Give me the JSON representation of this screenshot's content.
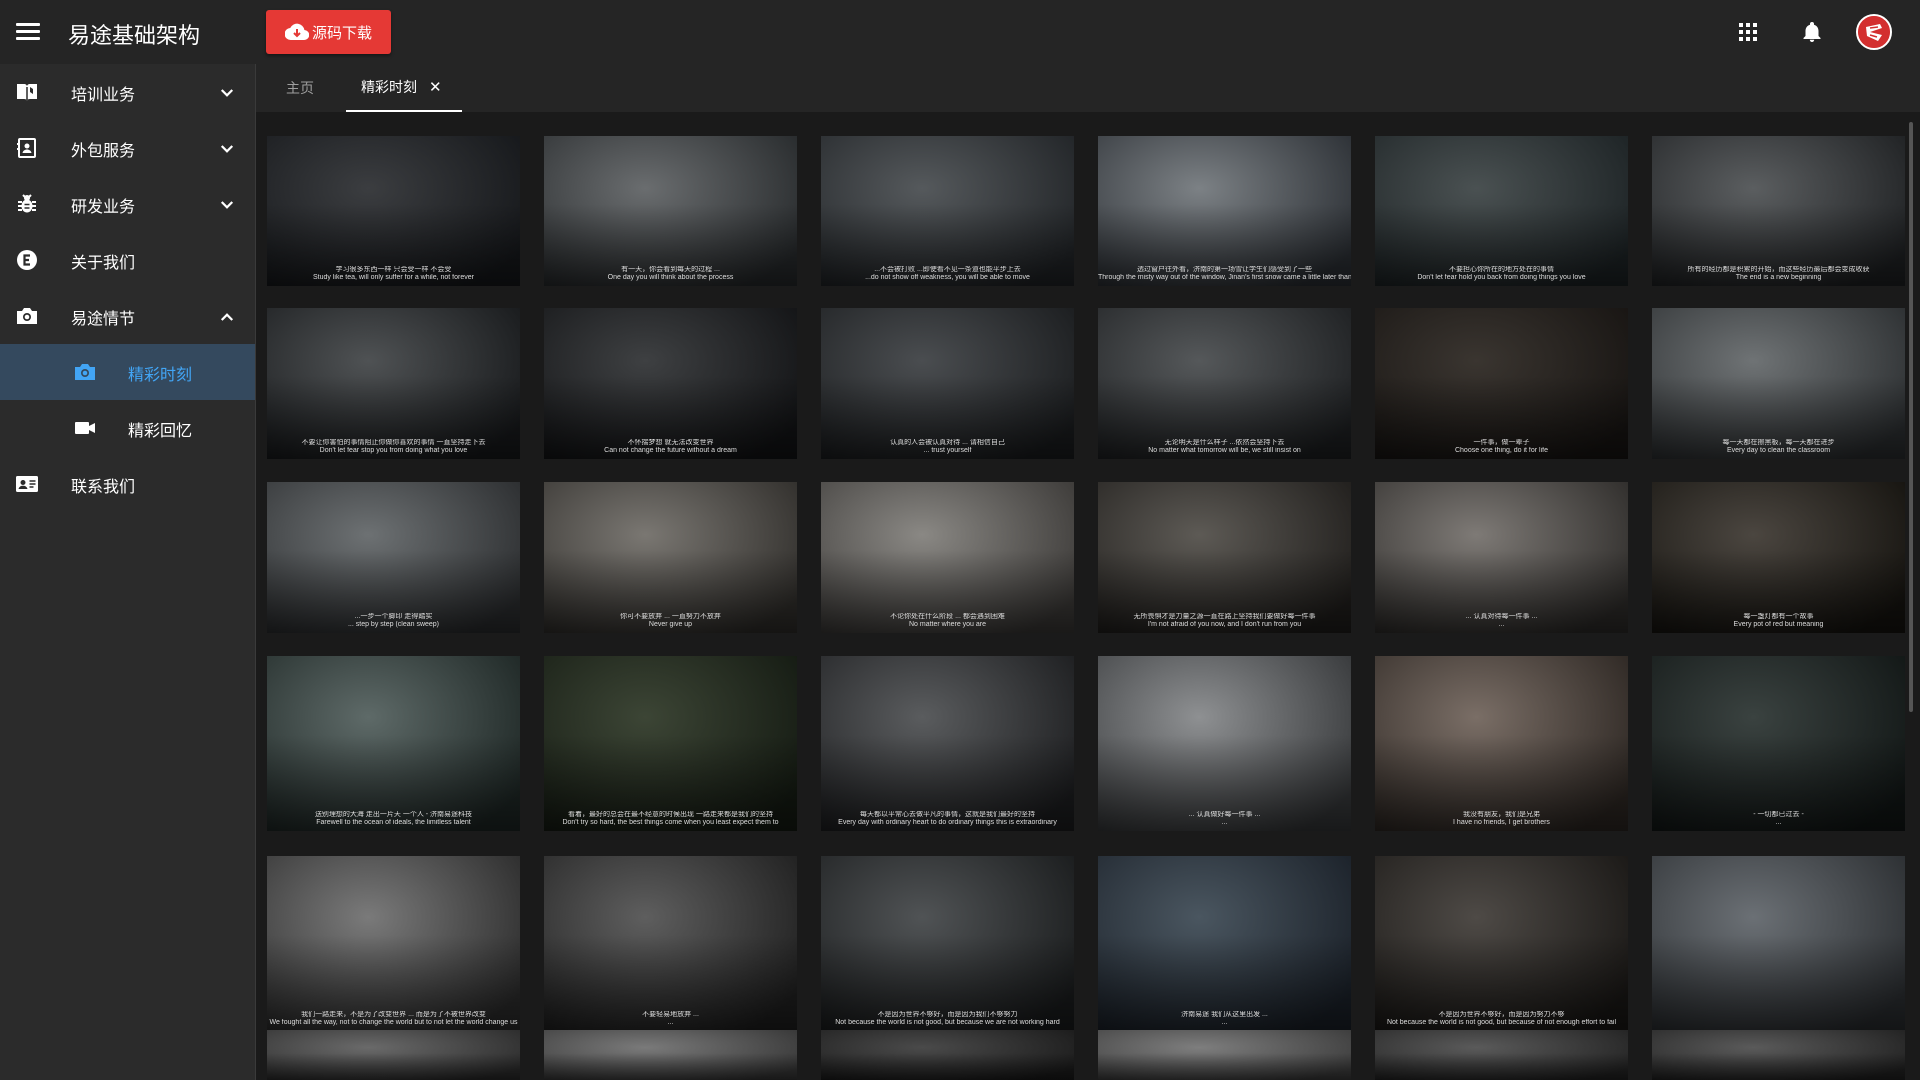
{
  "app": {
    "title": "易途基础架构",
    "download_label": "源码下载",
    "accent_color": "#e53935",
    "active_color": "#42a5f5"
  },
  "header_icons": [
    "apps-grid-icon",
    "bell-icon",
    "avatar-logo"
  ],
  "sidebar": {
    "items": [
      {
        "label": "培训业务",
        "icon": "book-icon",
        "chevron": "down"
      },
      {
        "label": "外包服务",
        "icon": "contact-card-icon",
        "chevron": "down"
      },
      {
        "label": "研发业务",
        "icon": "bug-icon",
        "chevron": "down"
      },
      {
        "label": "关于我们",
        "icon": "e-circle-icon"
      },
      {
        "label": "易途情节",
        "icon": "camera-icon",
        "chevron": "up",
        "expanded": true
      },
      {
        "label": "精彩时刻",
        "icon": "camera-icon",
        "sub": true,
        "active": true
      },
      {
        "label": "精彩回忆",
        "icon": "video-camera-icon",
        "sub": true
      },
      {
        "label": "联系我们",
        "icon": "contact-id-icon"
      }
    ]
  },
  "tabs": {
    "home": "主页",
    "active": "精彩时刻",
    "close_symbol": "✕"
  },
  "gallery": {
    "photos": [
      {
        "cap": [
          "学习很多东西一样 只会受一样 不会受",
          "Study like tea, will only suffer for a while, not forever"
        ],
        "tone": [
          "#3b3d40",
          "#15171a"
        ]
      },
      {
        "cap": [
          "有一天，你会看到每天的过程 ...",
          "One day you will think about the process"
        ],
        "tone": [
          "#6a6d6f",
          "#26292b"
        ]
      },
      {
        "cap": [
          "...不会被打败 ...即使看不见一条道也能平步上去",
          "...do not show off weakness, you will be able to move"
        ],
        "tone": [
          "#55595c",
          "#202326"
        ]
      },
      {
        "cap": [
          "透过窗户往外看，济南的第一场雪让学生们感受到了一些",
          "Through the misty way out of the window, Jinan's first snow came a little later than usual"
        ],
        "tone": [
          "#7c8185",
          "#2a2e33"
        ]
      },
      {
        "cap": [
          "不要担心你所在的地方处在的事情",
          "Don't let fear hold you back from doing things you love"
        ],
        "tone": [
          "#4a5152",
          "#1c2224"
        ]
      },
      {
        "cap": [
          "所有的经历都是积累的开始，而这些经历最后都会变成收获",
          "The end is a new beginning"
        ],
        "tone": [
          "#5b5e60",
          "#1e2022"
        ]
      },
      {
        "cap": [
          "不要让你害怕的事情阻止你做你喜欢的事情 一直坚持走下去",
          "Don't let fear stop you from doing what you love"
        ],
        "tone": [
          "#4f5254",
          "#17191b"
        ]
      },
      {
        "cap": [
          "不怀揣梦想 就无法改变世界",
          "Can not change the future without a dream"
        ],
        "tone": [
          "#3e4042",
          "#121315"
        ]
      },
      {
        "cap": [
          "认真的人会被认真对待 ... 请相信自己",
          "... trust yourself"
        ],
        "tone": [
          "#4a4d50",
          "#1a1c1e"
        ]
      },
      {
        "cap": [
          "无论明天是什么样子 ...依然会坚持下去",
          "No matter what tomorrow will be, we still insist on"
        ],
        "tone": [
          "#55585a",
          "#1d1f21"
        ]
      },
      {
        "cap": [
          "一件事，做一辈子",
          "Choose one thing, do it for life"
        ],
        "tone": [
          "#3a3530",
          "#171412"
        ]
      },
      {
        "cap": [
          "每一天都在擦黑板，每一天都在进步",
          "Every day to clean the classroom"
        ],
        "tone": [
          "#6f7375",
          "#2b2e30"
        ]
      },
      {
        "cap": [
          "...一步一个脚印 走得踏实",
          "... step by step (clean sweep)"
        ],
        "tone": [
          "#6d7173",
          "#2a2c2e"
        ]
      },
      {
        "cap": [
          "你可不要放弃 ... 一直努力不放弃",
          "Never give up"
        ],
        "tone": [
          "#7a7772",
          "#2f2d2a"
        ]
      },
      {
        "cap": [
          "不论你处在什么阶段 ... 都会遇到困难",
          "No matter where you are"
        ],
        "tone": [
          "#8a8884",
          "#3a3836"
        ]
      },
      {
        "cap": [
          "无所畏惧才是力量之源一直在路上坚持我们要做好每一件事",
          "I'm not afraid of you now, and I don't run from you"
        ],
        "tone": [
          "#5d5a55",
          "#1f1d1b"
        ]
      },
      {
        "cap": [
          "... 认真对待每一件事 ...",
          "..."
        ],
        "tone": [
          "#7e7a76",
          "#2d2b29"
        ]
      },
      {
        "cap": [
          "每一盏灯都有一个故事",
          "Every pot of red but meaning"
        ],
        "tone": [
          "#4b4640",
          "#15130f"
        ]
      },
      {
        "cap": [
          "送别理想的大海 走出一片天 一个人 - 济南易途科技",
          "Farewell to the ocean of ideals, the limitless talent"
        ],
        "tone": [
          "#5e6a68",
          "#1d2624"
        ]
      },
      {
        "cap": [
          "看着，最好的总会在最不经意的时候出现 一路走来都是我们的坚持",
          "Don't try so hard, the best things come when you least expect them to"
        ],
        "tone": [
          "#3c4535",
          "#141a12"
        ]
      },
      {
        "cap": [
          "每天都以平常心去做平凡的事情，这就是我们最好的坚持",
          "Every day with ordinary heart to do ordinary things this is extraordinary"
        ],
        "tone": [
          "#5a5c5e",
          "#1c1d1f"
        ]
      },
      {
        "cap": [
          "... 认真做好每一件事 ...",
          "..."
        ],
        "tone": [
          "#8e9092",
          "#353739"
        ]
      },
      {
        "cap": [
          "我没有朋友，我们是兄弟",
          "I have no friends, I get brothers"
        ],
        "tone": [
          "#7a6e66",
          "#2c2622"
        ]
      },
      {
        "cap": [
          "- 一切都已过去 -",
          "..."
        ],
        "tone": [
          "#3a4240",
          "#111615"
        ]
      },
      {
        "cap": [
          "我们一路走来，不是为了改变世界 ... 而是为了不被世界改变",
          "We fought all the way, not to change the world but to not let the world change us"
        ],
        "tone": [
          "#7a7a7a",
          "#2b2b2b"
        ]
      },
      {
        "cap": [
          "不要轻易地放弃 ...",
          "..."
        ],
        "tone": [
          "#5e5e5e",
          "#1f1f1f"
        ]
      },
      {
        "cap": [
          "不是因为世界不够好，而是因为我们不够努力",
          "Not because the world is not good, but because we are not working hard"
        ],
        "tone": [
          "#505355",
          "#191b1c"
        ]
      },
      {
        "cap": [
          "济南易途 我们从这里出发 ...",
          "..."
        ],
        "tone": [
          "#4a5660",
          "#1a2028"
        ]
      },
      {
        "cap": [
          "不是因为世界不够好，而是因为努力不够",
          "Not because the world is not good, but because of not enough effort to fail"
        ],
        "tone": [
          "#4e4a46",
          "#191715"
        ]
      },
      {
        "cap": [
          "",
          ""
        ],
        "tone": [
          "#6b7075",
          "#2a2d30"
        ]
      },
      {
        "cap": [
          "",
          ""
        ],
        "tone": [
          "#6a6a6a",
          "#2a2a2a"
        ]
      },
      {
        "cap": [
          "",
          ""
        ],
        "tone": [
          "#7a7a7a",
          "#353535"
        ]
      },
      {
        "cap": [
          "",
          ""
        ],
        "tone": [
          "#4a4a4a",
          "#1a1a1a"
        ]
      },
      {
        "cap": [
          "",
          ""
        ],
        "tone": [
          "#7e7e7e",
          "#3a3a3a"
        ]
      },
      {
        "cap": [
          "",
          ""
        ],
        "tone": [
          "#5a5a5a",
          "#222222"
        ]
      },
      {
        "cap": [
          "",
          ""
        ],
        "tone": [
          "#5a5a5a",
          "#202020"
        ]
      }
    ]
  }
}
